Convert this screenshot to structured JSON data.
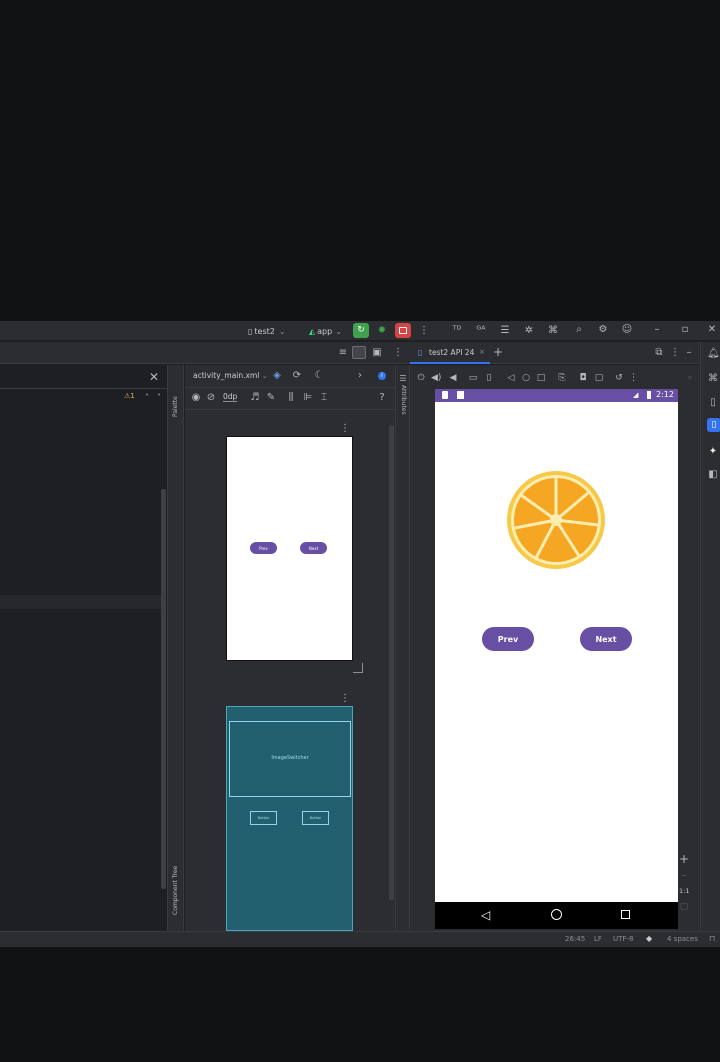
{
  "toolbar": {
    "config_name": "test2",
    "run_config": "app",
    "caret": "⌄"
  },
  "left_panel": {
    "warning_badge": "⚠1"
  },
  "palette": {
    "label": "Palette",
    "component_tree_label": "Component Tree"
  },
  "design": {
    "file_tab": "activity_main.xml",
    "margin_value": "0dp",
    "preview_prev": "Prev",
    "preview_next": "Next",
    "blueprint_image_label": "ImageSwitcher",
    "blueprint_btn1": "Button",
    "blueprint_btn2": "Button"
  },
  "attributes": {
    "label": "Attributes"
  },
  "running_device": {
    "tab_title": "test2 API 24",
    "status_time": "2:12",
    "prev_button": "Prev",
    "next_button": "Next",
    "zoom_ratio": "1:1",
    "orange_color": "#f5a623"
  },
  "status_bar": {
    "position": "26:45",
    "line_ending": "LF",
    "encoding": "UTF-8",
    "indent": "4 spaces"
  },
  "colors": {
    "accent": "#6750a4",
    "run_green": "#3fa34d",
    "stop_red": "#d64545",
    "blueprint": "#23606f"
  }
}
